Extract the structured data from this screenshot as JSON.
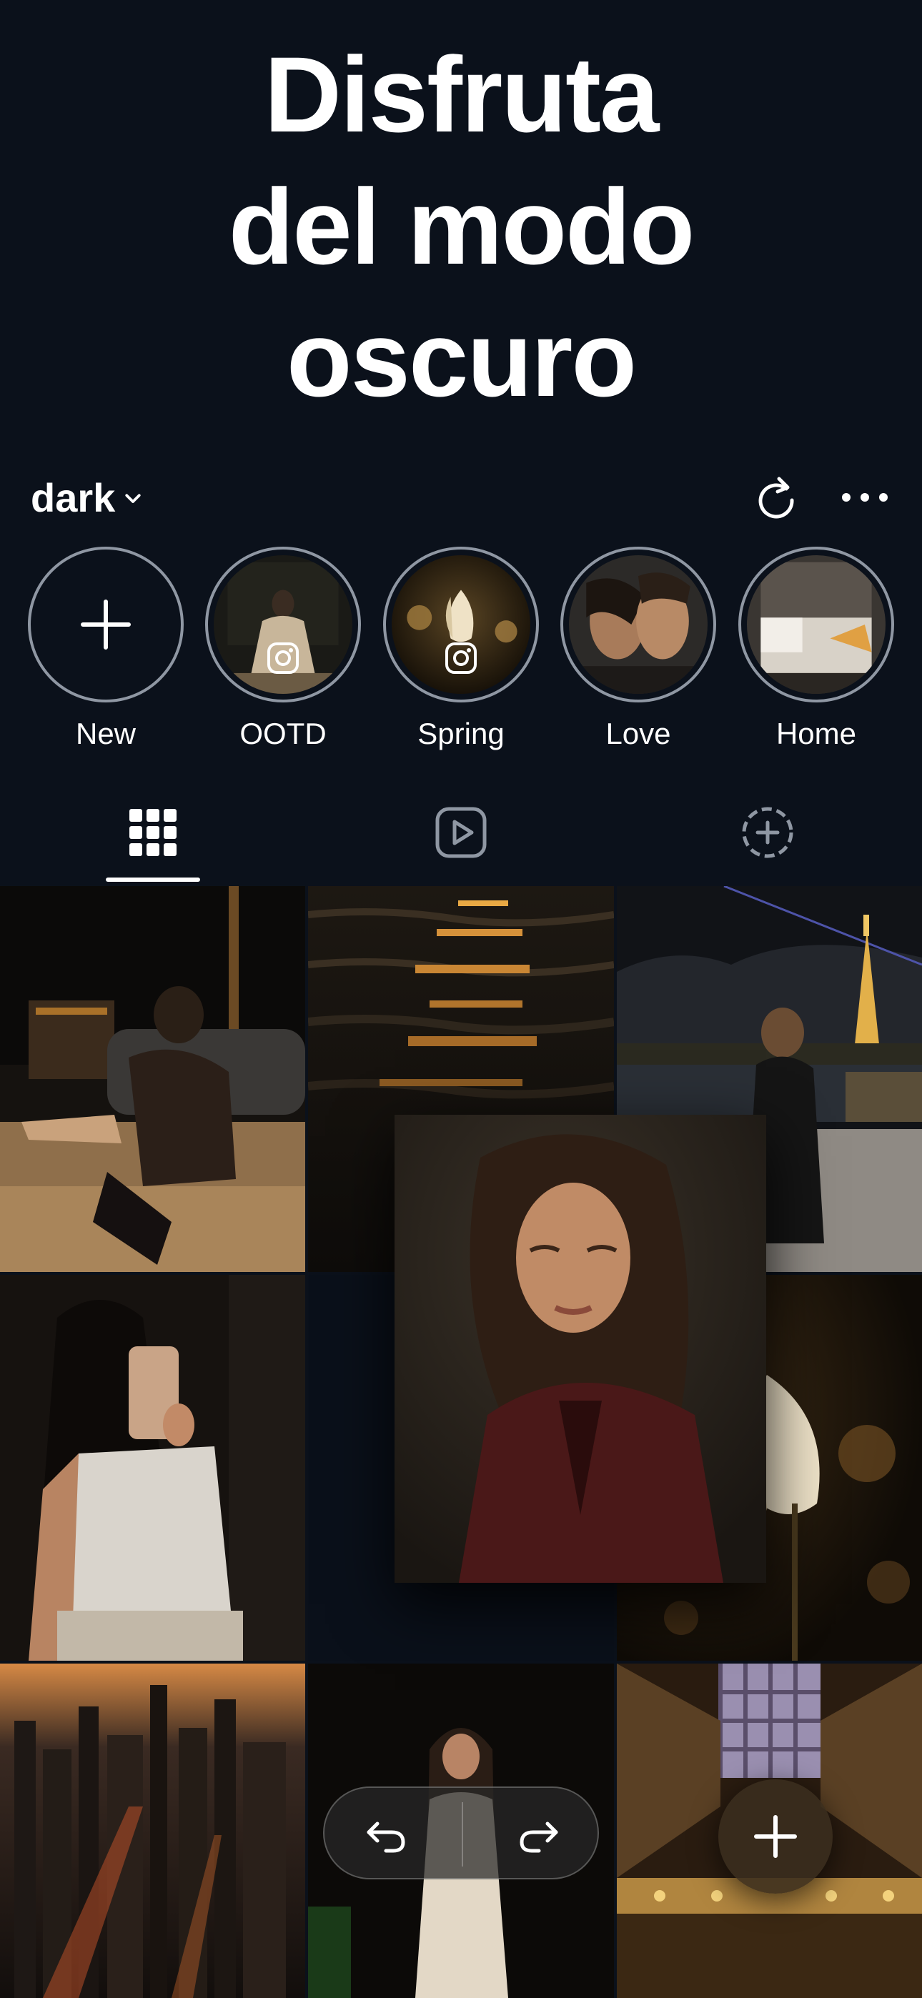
{
  "hero": {
    "line1": "Disfruta",
    "line2": "del modo",
    "line3": "oscuro"
  },
  "profile": {
    "username": "dark",
    "dropdown_icon": "chevron-down-icon",
    "refresh_icon": "refresh-icon",
    "more_icon": "more-horizontal-icon"
  },
  "highlights": [
    {
      "label": "New",
      "icon": "plus-icon"
    },
    {
      "label": "OOTD",
      "icon": "instagram-icon"
    },
    {
      "label": "Spring",
      "icon": "instagram-icon"
    },
    {
      "label": "Love"
    },
    {
      "label": "Home"
    }
  ],
  "tabs": [
    {
      "name": "grid",
      "icon": "grid-icon",
      "active": true
    },
    {
      "name": "reels",
      "icon": "play-icon",
      "active": false
    },
    {
      "name": "planner",
      "icon": "dashed-plus-icon",
      "active": false
    }
  ],
  "controls": {
    "undo_icon": "undo-icon",
    "redo_icon": "redo-icon",
    "add_icon": "plus-icon"
  },
  "colors": {
    "background": "#0b111b",
    "text": "#ffffff",
    "ring": "#8f97a3"
  }
}
